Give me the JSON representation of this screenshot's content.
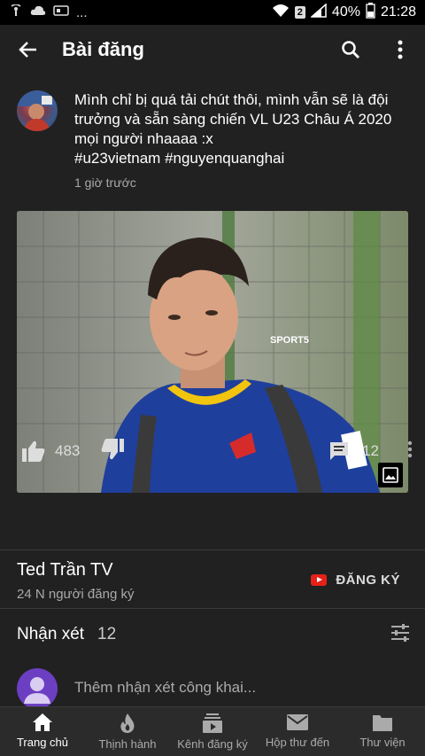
{
  "status_bar": {
    "battery": "40%",
    "time": "21:28",
    "sim_badge": "2",
    "more": "..."
  },
  "app_bar": {
    "title": "Bài đăng"
  },
  "post": {
    "text_line1": "Mình chỉ bị quá tải chút thôi, mình vẫn sẽ là đội",
    "text_line2": "trưởng và sẵn sàng chiến VL U23 Châu Á 2020",
    "text_line3": "mọi người nhaaaa :x",
    "text_line4": "#u23vietnam #nguyenquanghai",
    "time": "1 giờ trước",
    "image_watermark": "SPORT5"
  },
  "actions": {
    "likes": "483",
    "comments": "12"
  },
  "channel": {
    "name": "Ted Trần TV",
    "subscribers": "24 N người đăng ký",
    "subscribe_label": "ĐĂNG KÝ"
  },
  "comments": {
    "title": "Nhận xét",
    "count": "12",
    "placeholder": "Thêm nhận xét công khai..."
  },
  "bottom_nav": {
    "items": [
      {
        "label": "Trang chủ",
        "icon": "home-icon",
        "active": true
      },
      {
        "label": "Thịnh hành",
        "icon": "trending-icon",
        "active": false
      },
      {
        "label": "Kênh đăng ký",
        "icon": "subscriptions-icon",
        "active": false
      },
      {
        "label": "Hộp thư đến",
        "icon": "inbox-icon",
        "active": false
      },
      {
        "label": "Thư viện",
        "icon": "library-icon",
        "active": false
      }
    ]
  },
  "colors": {
    "background": "#212121",
    "youtube_red": "#e62117",
    "text_secondary": "#aaaaaa"
  }
}
